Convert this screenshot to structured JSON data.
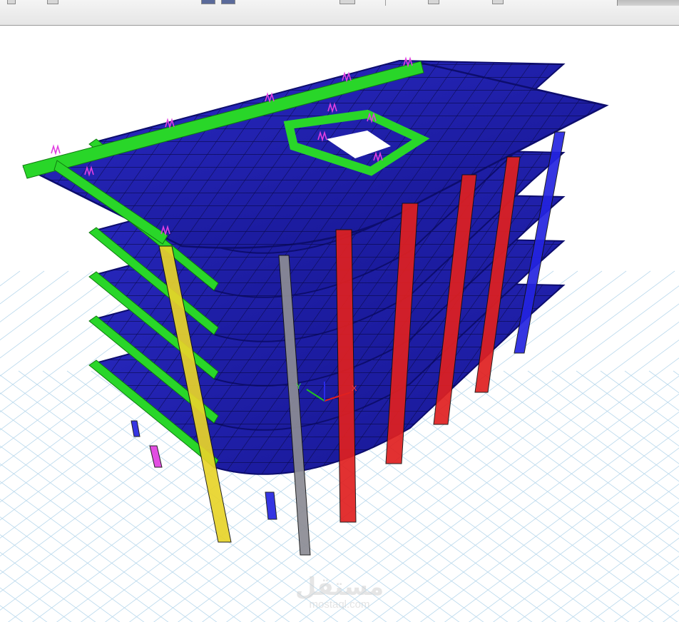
{
  "app": {
    "toolbar_icons": [
      "undo-icon",
      "redo-icon",
      "window-icon",
      "window-icon",
      "window-icon",
      "window-icon"
    ]
  },
  "viewport": {
    "axis_labels": {
      "x": "X",
      "y": "Y"
    },
    "colors": {
      "slab": "#1c1ca8",
      "slab_dark": "#0d0d6e",
      "beam_green": "#29d629",
      "column_red": "#e02020",
      "column_yellow": "#e8d42a",
      "column_grey": "#8c8c94",
      "column_blue": "#2424e0",
      "support": "#e040e0",
      "grid": "#b8d8ec"
    }
  },
  "watermark": {
    "arabic": "مستقل",
    "latin": "mostaql.com"
  }
}
